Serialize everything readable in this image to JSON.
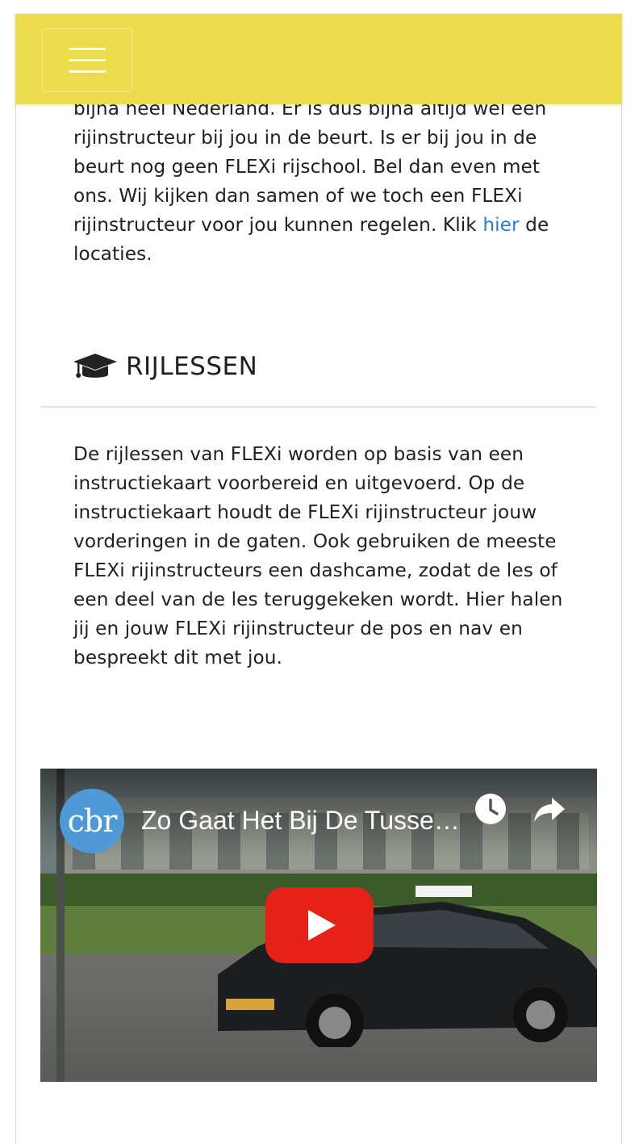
{
  "navbar": {
    "menu_label": "Menu"
  },
  "intro": {
    "text_before_link": "bijna heel Nederland. Er is dus bijna altijd wel een rijinstructeur bij jou in de beurt. Is er bij jou in de beurt nog geen FLEXi rijschool. Bel dan even met ons. Wij kijken dan samen of we toch een FLEXi rijinstructeur voor jou kunnen regelen. Klik ",
    "link_text": "hier",
    "text_after_link": " de locaties."
  },
  "section": {
    "icon": "graduation-cap-icon",
    "title": "RIJLESSEN"
  },
  "body": {
    "text": "De rijlessen van FLEXi worden op basis van een instructiekaart voorbereid en uitgevoerd. Op de instructiekaart houdt de FLEXi rijinstructeur jouw vorderingen in de gaten. Ook gebruiken de meeste FLEXi rijinstructeurs een dashcame, zodat de les of een deel van de les teruggekeken wordt. Hier halen jij en jouw FLEXi rijinstructeur de pos en nav en bespreekt dit met jou."
  },
  "video": {
    "channel": "cbr",
    "title": "Zo Gaat Het Bij De Tussentijdse Toets",
    "icons": [
      "clock-icon",
      "share-icon",
      "play-icon"
    ]
  },
  "colors": {
    "navbar": "#ecdb4d",
    "link": "#2a7ae2",
    "youtube_red": "#e62117",
    "cbr_blue": "#4f9ad6"
  }
}
